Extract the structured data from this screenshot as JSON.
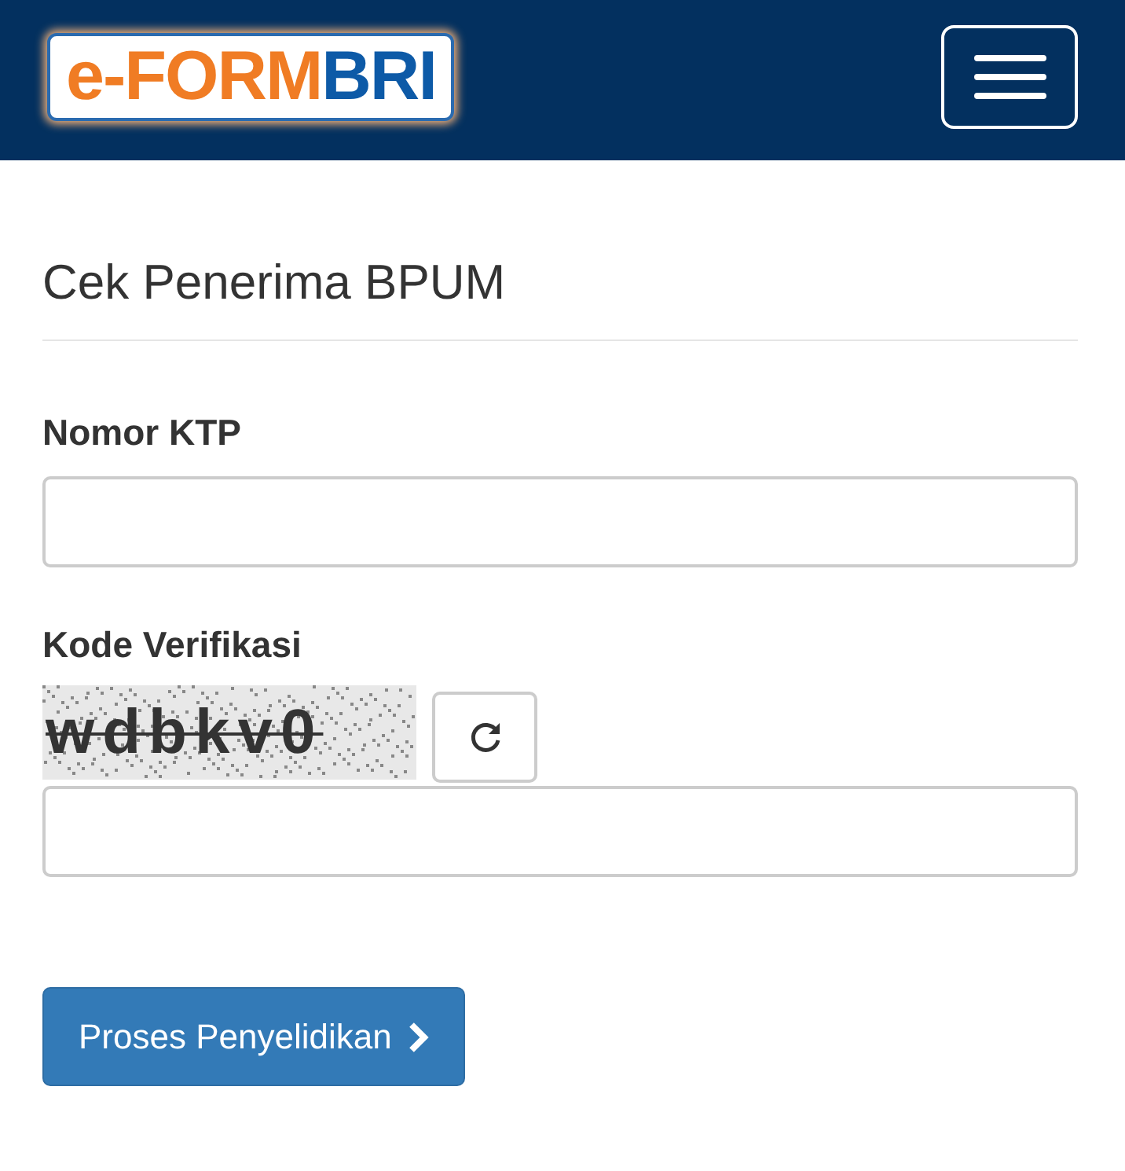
{
  "header": {
    "logo": [
      {
        "text": "e-FORM",
        "color": "#f07c24"
      },
      {
        "text": "BRI",
        "color": "#0d5aa7"
      }
    ]
  },
  "page_title": "Cek Penerima BPUM",
  "fields": [
    {
      "label": "Nomor KTP",
      "kind": "text"
    },
    {
      "label": "Kode Verifikasi",
      "kind": "captcha",
      "captcha": "wdbkv0"
    }
  ],
  "submit": {
    "label": "Proses Penyelidikan"
  }
}
